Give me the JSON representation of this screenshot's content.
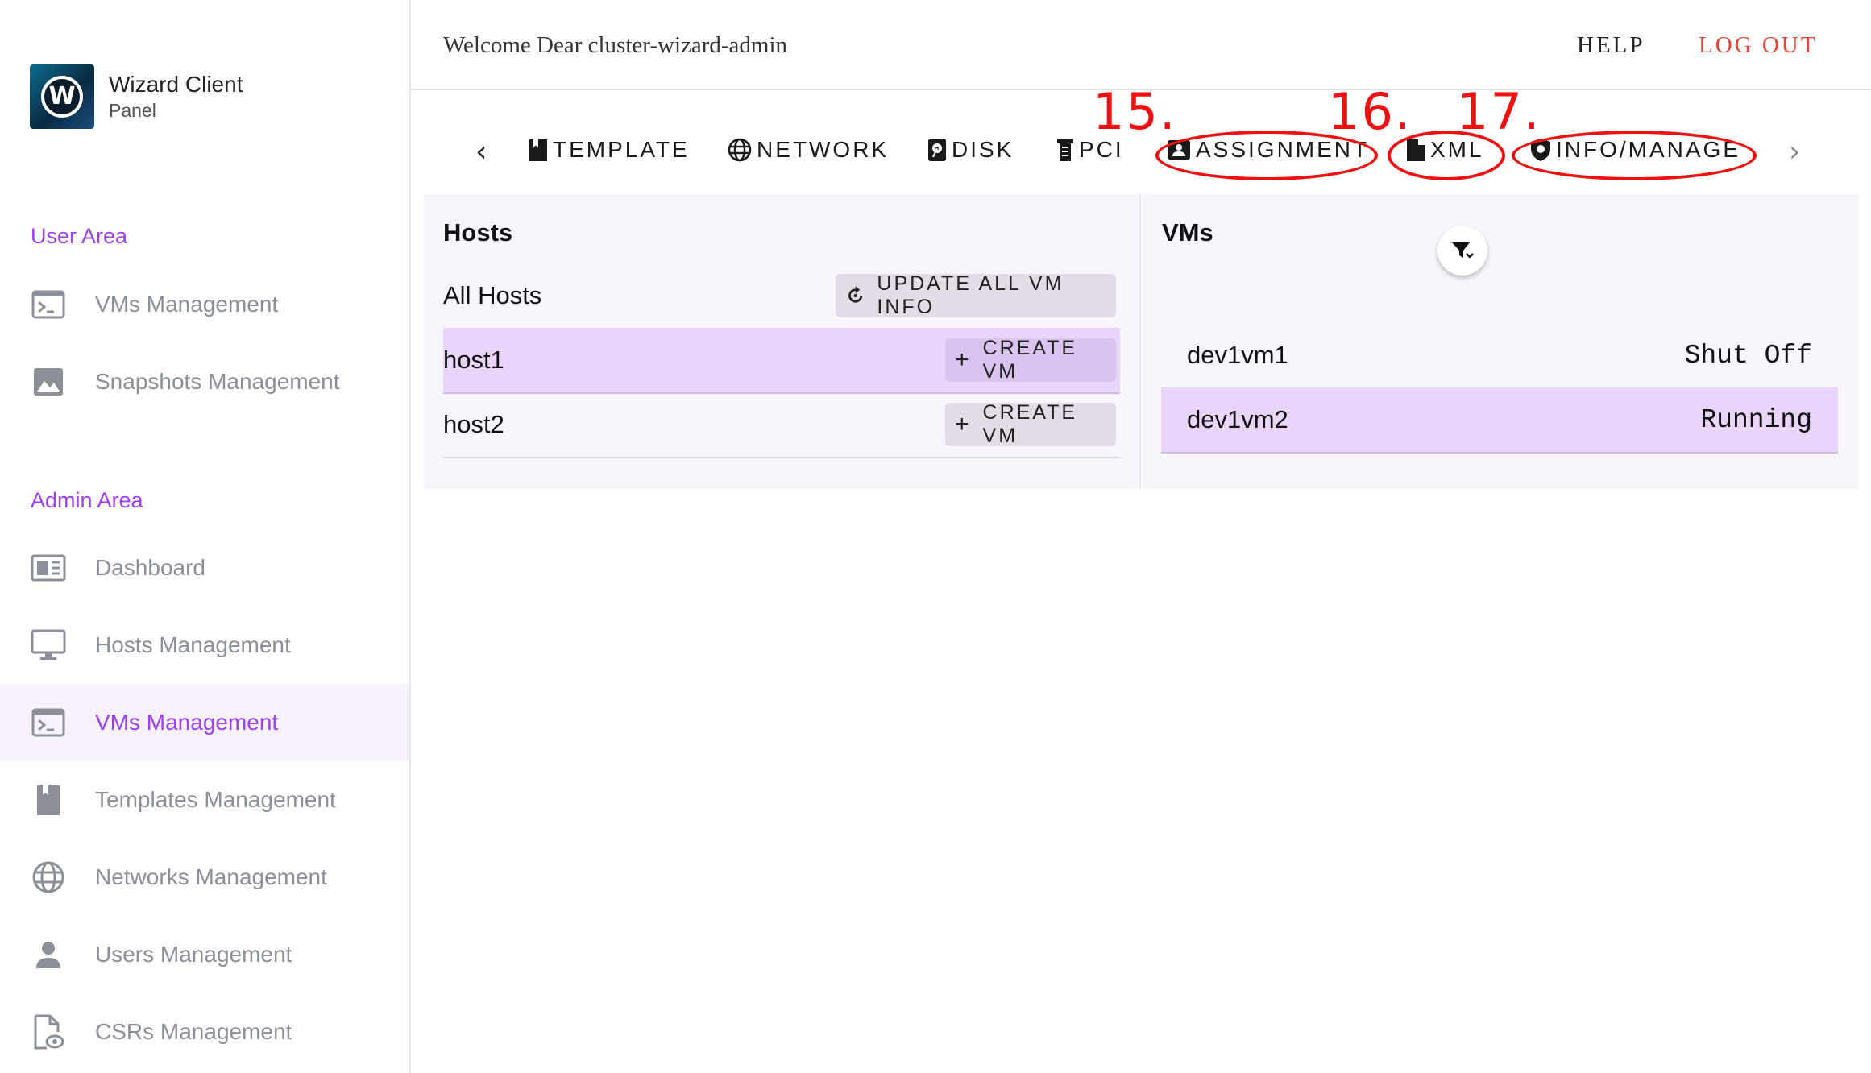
{
  "brand": {
    "title": "Wizard Client",
    "subtitle": "Panel",
    "logo_letter": "W"
  },
  "sidebar": {
    "user_area_title": "User Area",
    "user_items": [
      {
        "label": "VMs Management",
        "icon": "terminal-icon"
      },
      {
        "label": "Snapshots Management",
        "icon": "image-icon"
      }
    ],
    "admin_area_title": "Admin Area",
    "admin_items": [
      {
        "label": "Dashboard",
        "icon": "dashboard-icon"
      },
      {
        "label": "Hosts Management",
        "icon": "monitor-icon"
      },
      {
        "label": "VMs Management",
        "icon": "terminal-icon",
        "active": true
      },
      {
        "label": "Templates Management",
        "icon": "bookmark-icon"
      },
      {
        "label": "Networks Management",
        "icon": "globe-icon"
      },
      {
        "label": "Users Management",
        "icon": "person-icon"
      },
      {
        "label": "CSRs Management",
        "icon": "file-eye-icon"
      }
    ]
  },
  "header": {
    "welcome": "Welcome Dear cluster-wizard-admin",
    "help": "HELP",
    "logout": "LOG OUT"
  },
  "tabs": {
    "items": [
      {
        "label": "TEMPLATE",
        "icon": "bookmark-icon"
      },
      {
        "label": "NETWORK",
        "icon": "globe-icon"
      },
      {
        "label": "DISK",
        "icon": "disk-icon"
      },
      {
        "label": "PCI",
        "icon": "pci-icon"
      },
      {
        "label": "ASSIGNMENT",
        "icon": "contact-card-icon"
      },
      {
        "label": "XML",
        "icon": "file-icon"
      },
      {
        "label": "INFO/MANAGE",
        "icon": "shield-icon"
      }
    ],
    "annotations": [
      "15.",
      "16.",
      "17."
    ],
    "annotation_color": "#ee1111"
  },
  "hosts": {
    "title": "Hosts",
    "all_hosts_label": "All Hosts",
    "update_button": "UPDATE ALL VM INFO",
    "rows": [
      {
        "name": "host1",
        "button": "CREATE VM",
        "selected": true
      },
      {
        "name": "host2",
        "button": "CREATE VM",
        "selected": false
      }
    ]
  },
  "vms": {
    "title": "VMs",
    "rows": [
      {
        "name": "dev1vm1",
        "status": "Shut Off",
        "selected": false
      },
      {
        "name": "dev1vm2",
        "status": "Running",
        "selected": true
      }
    ]
  },
  "colors": {
    "accent": "#9b3ff0",
    "logout": "#e8443b",
    "selected_row": "#e9d5fb",
    "panel_bg": "#f9f5fd"
  }
}
